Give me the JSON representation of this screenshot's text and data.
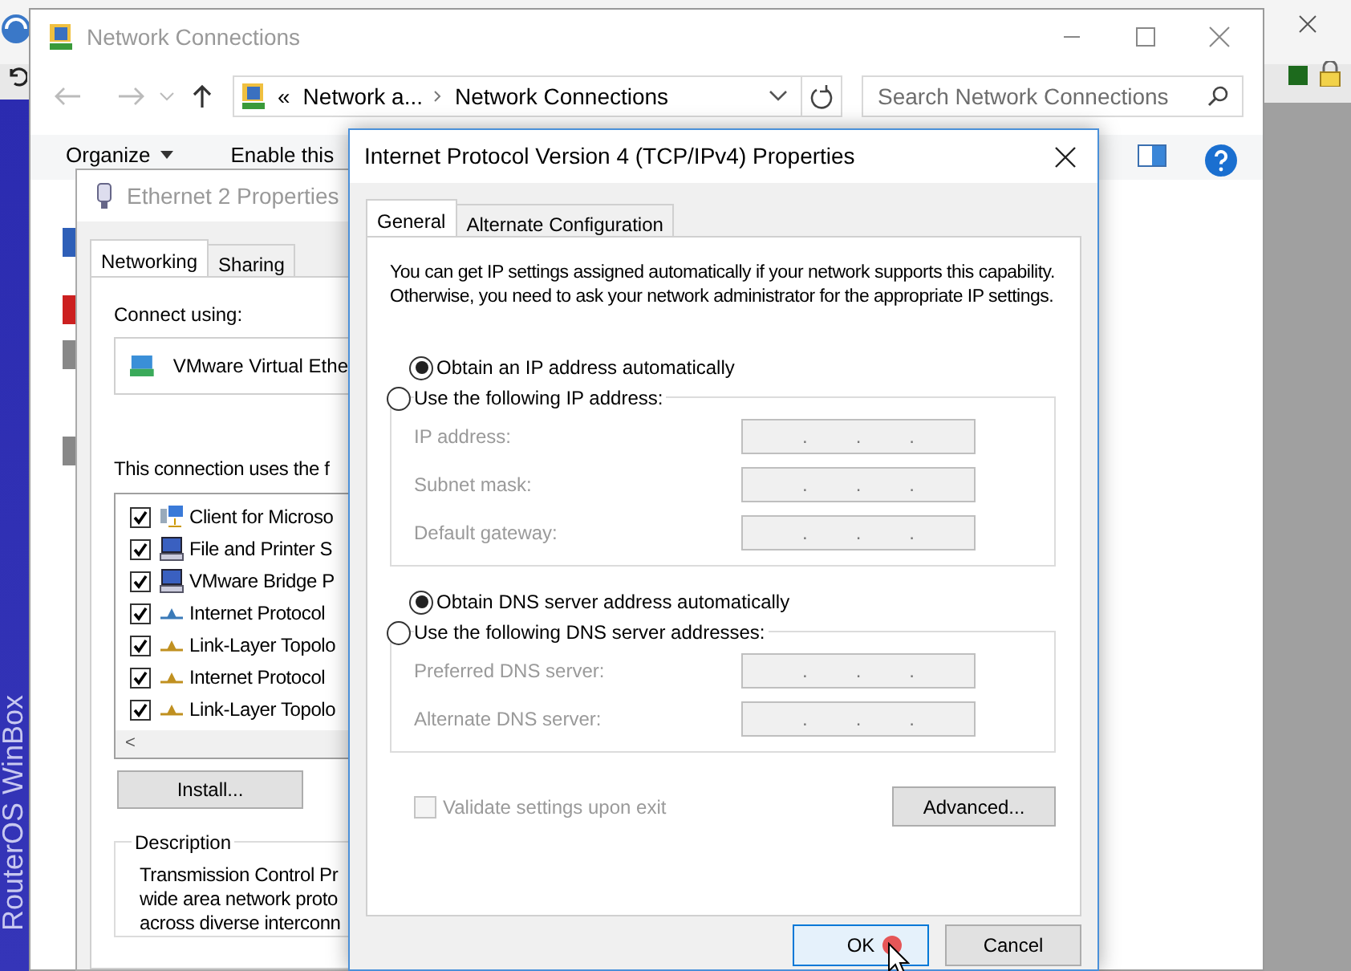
{
  "desktop": {
    "side_label": "RouterOS WinBox"
  },
  "explorer": {
    "title": "Network Connections",
    "overflow": "«",
    "breadcrumb": [
      "Network a...",
      "Network Connections"
    ],
    "search": {
      "placeholder": "Search Network Connections"
    },
    "commands": [
      {
        "label": "Organize",
        "kind": "menu"
      },
      {
        "label": "Enable this",
        "kind": "plain"
      }
    ]
  },
  "ethernet_dialog": {
    "title": "Ethernet 2 Properties",
    "tabs": [
      {
        "label": "Networking",
        "selected": true
      },
      {
        "label": "Sharing",
        "selected": false
      }
    ],
    "connect_label": "Connect using:",
    "adapter": "VMware Virtual Ethe",
    "items_label": "This connection uses the f",
    "items": [
      {
        "label": "Client for Microso",
        "checked": true,
        "kind": "client"
      },
      {
        "label": "File and Printer S",
        "checked": true,
        "kind": "service"
      },
      {
        "label": "VMware Bridge P",
        "checked": true,
        "kind": "service"
      },
      {
        "label": "Internet Protocol",
        "checked": true,
        "kind": "protocol"
      },
      {
        "label": "Link-Layer Topolo",
        "checked": true,
        "kind": "protocol"
      },
      {
        "label": "Internet Protocol",
        "checked": true,
        "kind": "protocol"
      },
      {
        "label": "Link-Layer Topolo",
        "checked": true,
        "kind": "protocol"
      }
    ],
    "scroll_left": "<",
    "install_button": "Install...",
    "description_title": "Description",
    "description_lines": [
      "Transmission Control Pr",
      "wide area network proto",
      "across diverse interconn"
    ]
  },
  "ipv4_dialog": {
    "title": "Internet Protocol Version 4 (TCP/IPv4) Properties",
    "tabs": [
      {
        "label": "General",
        "selected": true
      },
      {
        "label": "Alternate Configuration",
        "selected": false
      }
    ],
    "intro": "You can get IP settings assigned automatically if your network supports this capability. Otherwise, you need to ask your network administrator for the appropriate IP settings.",
    "ip_modes": [
      {
        "label": "Obtain an IP address automatically",
        "selected": true
      },
      {
        "label": "Use the following IP address:",
        "selected": false
      }
    ],
    "ip_fields": [
      {
        "label": "IP address:",
        "disabled": true,
        "separators": [
          ".",
          ".",
          "."
        ]
      },
      {
        "label": "Subnet mask:",
        "disabled": true,
        "separators": [
          ".",
          ".",
          "."
        ]
      },
      {
        "label": "Default gateway:",
        "disabled": true,
        "separators": [
          ".",
          ".",
          "."
        ]
      }
    ],
    "dns_modes": [
      {
        "label": "Obtain DNS server address automatically",
        "selected": true
      },
      {
        "label": "Use the following DNS server addresses:",
        "selected": false
      }
    ],
    "dns_fields": [
      {
        "label": "Preferred DNS server:",
        "disabled": true,
        "separators": [
          ".",
          ".",
          "."
        ]
      },
      {
        "label": "Alternate DNS server:",
        "disabled": true,
        "separators": [
          ".",
          ".",
          "."
        ]
      }
    ],
    "validate": {
      "label": "Validate settings upon exit",
      "checked": false,
      "disabled": true
    },
    "advanced_button": "Advanced...",
    "ok_button": "OK",
    "cancel_button": "Cancel"
  }
}
